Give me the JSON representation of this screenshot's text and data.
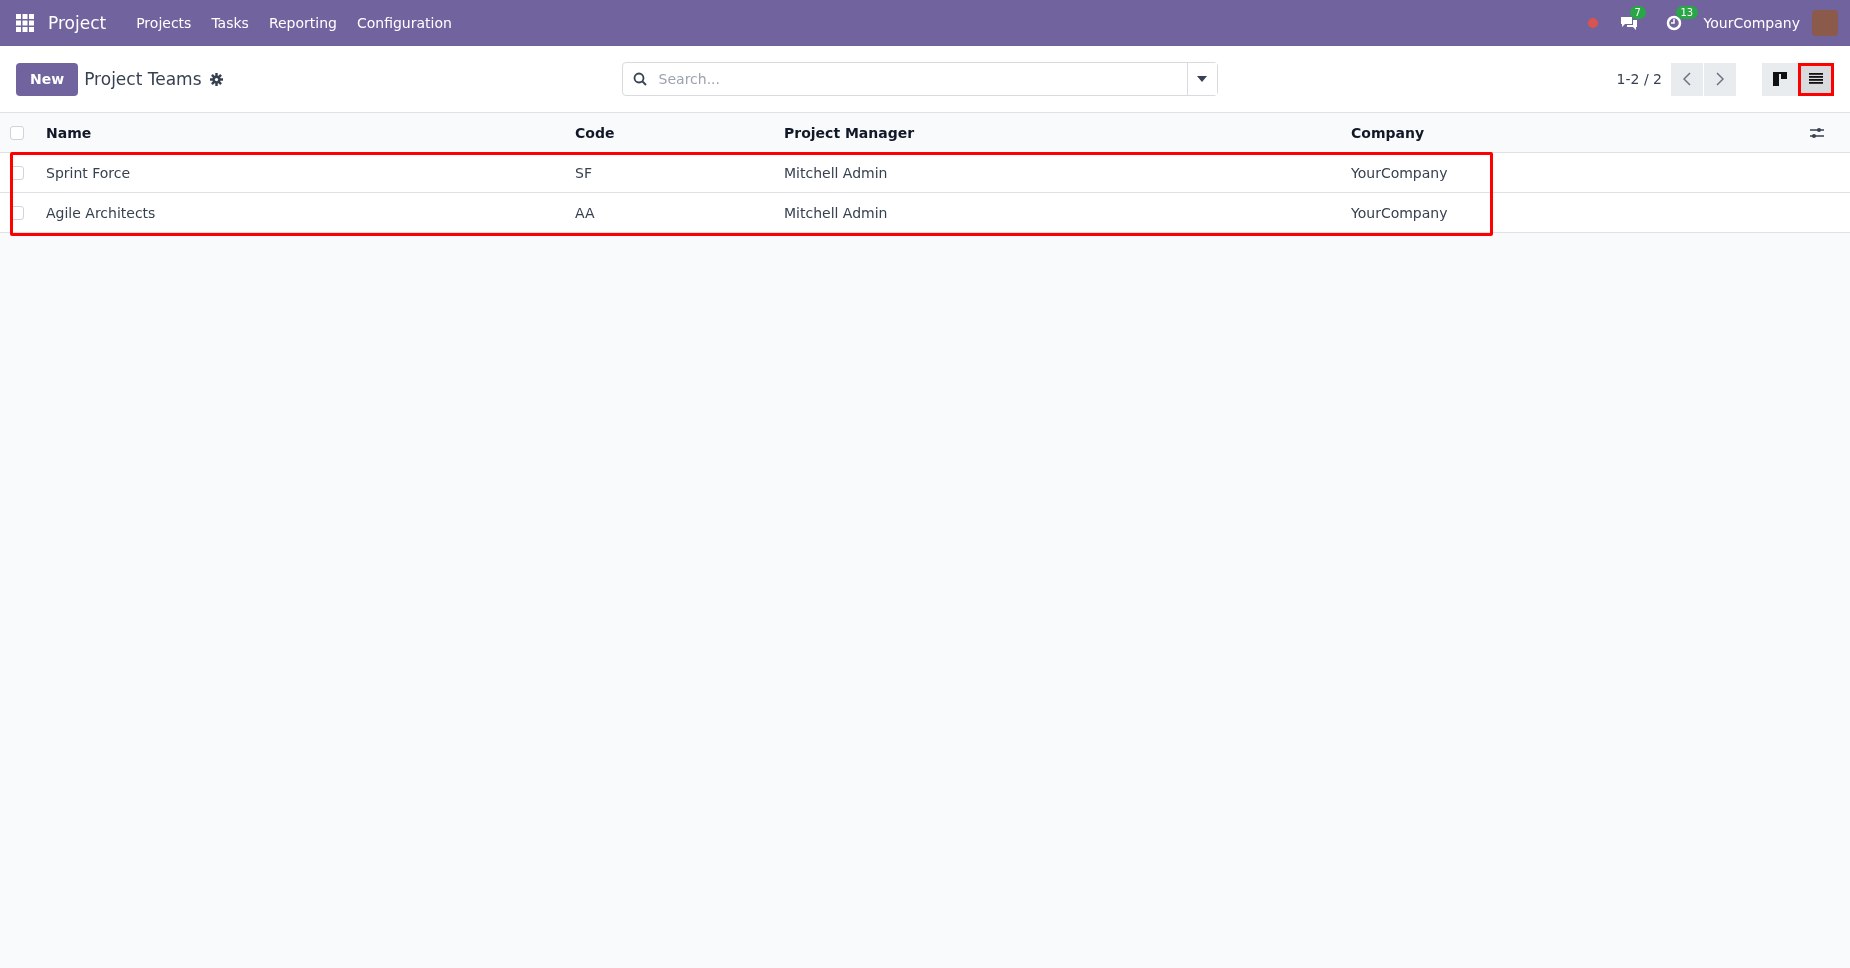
{
  "navbar": {
    "app": "Project",
    "menu": [
      "Projects",
      "Tasks",
      "Reporting",
      "Configuration"
    ],
    "messages_count": "7",
    "activities_count": "13",
    "company": "YourCompany"
  },
  "control_panel": {
    "new_button": "New",
    "title": "Project Teams",
    "search": {
      "placeholder": "Search..."
    },
    "pager": "1-2 / 2",
    "views": [
      {
        "kind": "kanban",
        "selected": false,
        "highlighted": false
      },
      {
        "kind": "list",
        "selected": true,
        "highlighted": true
      }
    ]
  },
  "table": {
    "columns": [
      "Name",
      "Code",
      "Project Manager",
      "Company"
    ],
    "select_all_checked": false,
    "rows_highlighted": true,
    "rows": [
      {
        "cells": [
          "Sprint Force",
          "SF",
          "Mitchell Admin",
          "YourCompany"
        ],
        "checked": false
      },
      {
        "cells": [
          "Agile Architects",
          "AA",
          "Mitchell Admin",
          "YourCompany"
        ],
        "checked": false
      }
    ]
  }
}
